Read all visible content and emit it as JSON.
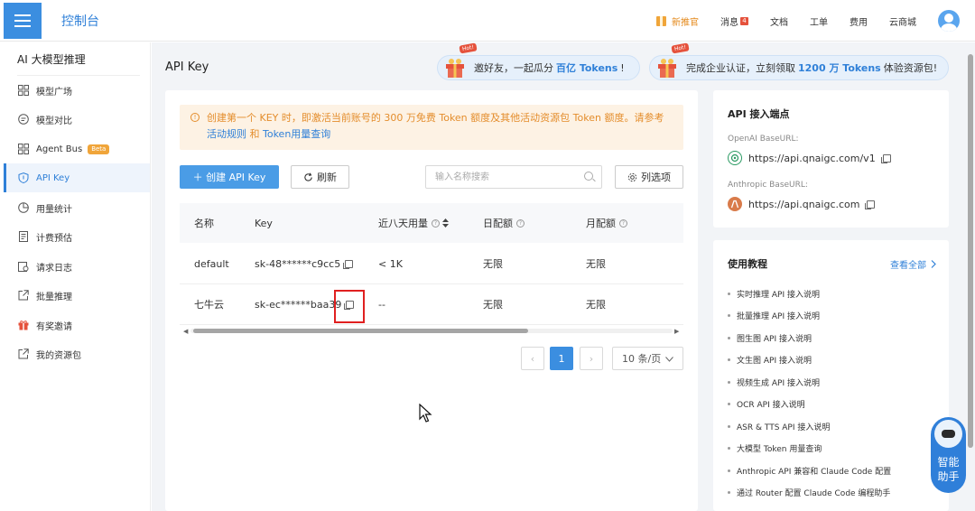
{
  "topbar": {
    "title": "控制台",
    "nav": {
      "promo": "新推官",
      "messages": "消息",
      "messages_badge": "4",
      "docs": "文档",
      "tickets": "工单",
      "billing": "费用",
      "store": "云商城"
    }
  },
  "sidebar": {
    "title": "AI 大模型推理",
    "items": [
      {
        "label": "模型广场"
      },
      {
        "label": "模型对比"
      },
      {
        "label": "Agent Bus",
        "badge": "Beta"
      },
      {
        "label": "API Key"
      },
      {
        "label": "用量统计"
      },
      {
        "label": "计费预估"
      },
      {
        "label": "请求日志"
      },
      {
        "label": "批量推理"
      },
      {
        "label": "有奖邀请"
      },
      {
        "label": "我的资源包"
      }
    ]
  },
  "page": {
    "title": "API Key"
  },
  "banners": [
    {
      "hot": "Hot!",
      "prefix": "邀好友，一起瓜分",
      "highlight": "百亿 Tokens",
      "suffix": "!"
    },
    {
      "hot": "Hot!",
      "prefix": "完成企业认证，立刻领取",
      "highlight": "1200 万 Tokens",
      "suffix": "体验资源包!"
    }
  ],
  "notice": {
    "text": "创建第一个 KEY 时，即激活当前账号的 300 万免费 Token 额度及其他活动资源包 Token 额度。请参考",
    "link1": "活动规则",
    "and": "和",
    "link2": "Token用量查询"
  },
  "toolbar": {
    "create_label": "＋ 创建 API Key",
    "refresh_label": "刷新",
    "search_placeholder": "输入名称搜索",
    "columns_label": "列选项"
  },
  "table": {
    "headers": {
      "name": "名称",
      "key": "Key",
      "usage": "近八天用量",
      "daily": "日配额",
      "monthly": "月配额"
    },
    "rows": [
      {
        "name": "default",
        "key": "sk-48******c9cc5",
        "usage": "< 1K",
        "daily": "无限",
        "monthly": "无限"
      },
      {
        "name": "七牛云",
        "key": "sk-ec******baa39",
        "usage": "--",
        "daily": "无限",
        "monthly": "无限"
      }
    ]
  },
  "pagination": {
    "prev": "‹",
    "current": "1",
    "next": "›",
    "page_size": "10 条/页"
  },
  "endpoints": {
    "title": "API 接入端点",
    "openai_label": "OpenAI BaseURL:",
    "openai_url": "https://api.qnaigc.com/v1",
    "anthropic_label": "Anthropic BaseURL:",
    "anthropic_url": "https://api.qnaigc.com"
  },
  "tutorials": {
    "title": "使用教程",
    "view_all": "查看全部",
    "items": [
      "实时推理 API 接入说明",
      "批量推理 API 接入说明",
      "图生图 API 接入说明",
      "文生图 API 接入说明",
      "视频生成 API 接入说明",
      "OCR API 接入说明",
      "ASR & TTS API 接入说明",
      "大模型 Token 用量查询",
      "Anthropic API 兼容和 Claude Code 配置",
      "通过 Router 配置 Claude Code 编程助手"
    ]
  },
  "assistant": {
    "label_line1": "智能",
    "label_line2": "助手"
  },
  "colors": {
    "accent": "#3b8ee0",
    "warning": "#e48d2c",
    "highlight_box": "#e02020"
  }
}
